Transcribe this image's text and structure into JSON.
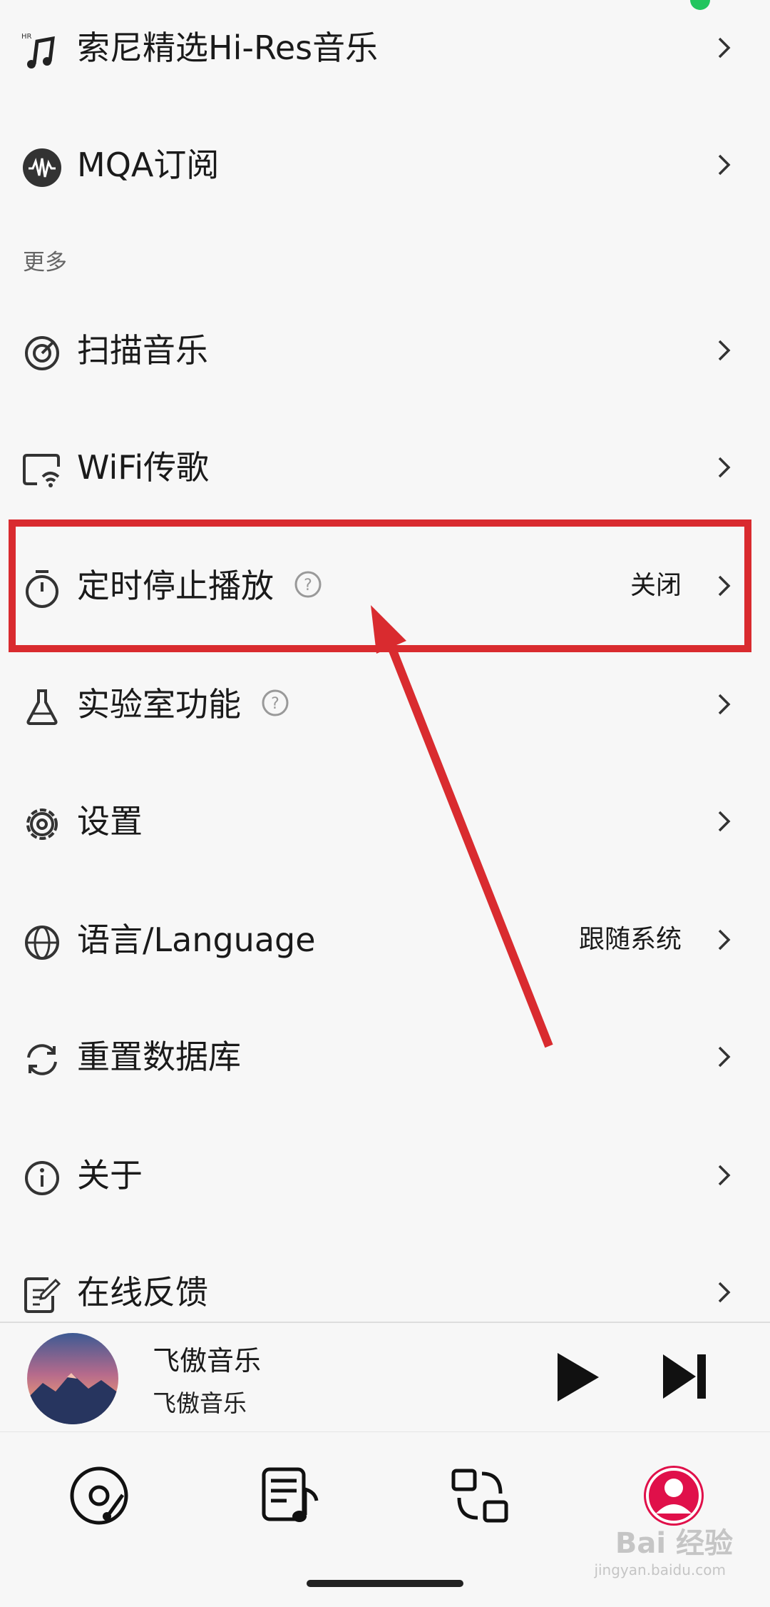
{
  "menu_top": [
    {
      "label": "索尼精选Hi-Res音乐",
      "icon": "hi-res-music-note-icon"
    },
    {
      "label": "MQA订阅",
      "icon": "mqa-waveform-icon"
    }
  ],
  "section_more": "更多",
  "menu_more": [
    {
      "label": "扫描音乐",
      "icon": "scan-target-icon",
      "value": ""
    },
    {
      "label": "WiFi传歌",
      "icon": "wifi-transfer-icon",
      "value": ""
    },
    {
      "label": "定时停止播放",
      "icon": "timer-icon",
      "value": "关闭",
      "help": true
    },
    {
      "label": "实验室功能",
      "icon": "flask-icon",
      "value": "",
      "help": true
    },
    {
      "label": "设置",
      "icon": "gear-icon",
      "value": ""
    },
    {
      "label": "语言/Language",
      "icon": "globe-icon",
      "value": "跟随系统"
    },
    {
      "label": "重置数据库",
      "icon": "refresh-icon",
      "value": ""
    },
    {
      "label": "关于",
      "icon": "info-icon",
      "value": ""
    },
    {
      "label": "在线反馈",
      "icon": "feedback-edit-icon",
      "value": ""
    }
  ],
  "player": {
    "title": "飞傲音乐",
    "artist": "飞傲音乐"
  },
  "nav": [
    {
      "name": "nav-disc",
      "icon": "disc-icon"
    },
    {
      "name": "nav-playlist",
      "icon": "playlist-icon"
    },
    {
      "name": "nav-switch",
      "icon": "device-switch-icon"
    },
    {
      "name": "nav-profile",
      "icon": "profile-icon",
      "active": true
    }
  ],
  "watermark": "Bai 经验",
  "watermark_sub": "jingyan.baidu.com",
  "colors": {
    "accent": "#e0104a",
    "annotation": "#d92b2f",
    "background": "#f7f7f7"
  }
}
